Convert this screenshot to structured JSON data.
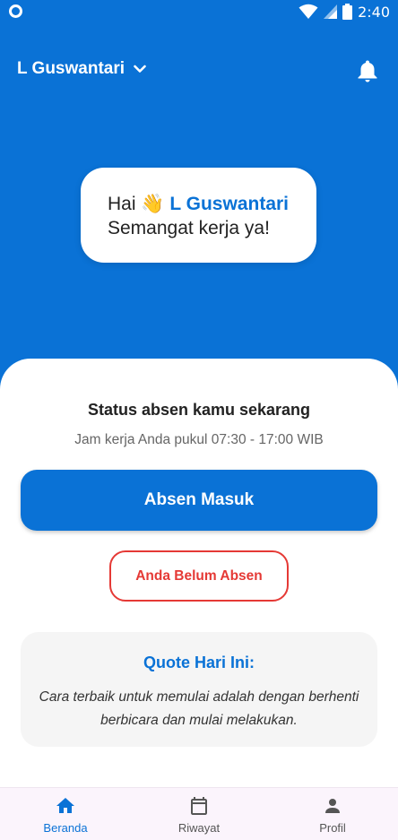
{
  "status_bar": {
    "time": "2:40",
    "icons": [
      "app-notification-icon",
      "wifi-icon",
      "signal-icon",
      "battery-icon"
    ]
  },
  "header": {
    "user_name": "L Guswantari",
    "dropdown_icon": "chevron-down-icon",
    "notification_icon": "bell-icon"
  },
  "greeting": {
    "prefix": "Hai",
    "emoji": "👋",
    "name": "L Guswantari",
    "message": "Semangat kerja ya!"
  },
  "attendance": {
    "title": "Status absen kamu sekarang",
    "work_hours": "Jam kerja Anda pukul 07:30 - 17:00 WIB",
    "checkin_button": "Absen Masuk",
    "status_badge": "Anda Belum Absen"
  },
  "quote": {
    "title": "Quote Hari Ini:",
    "text": "Cara terbaik untuk memulai adalah dengan berhenti berbicara dan mulai melakukan."
  },
  "bottom_nav": {
    "items": [
      {
        "label": "Beranda",
        "icon": "home-icon",
        "active": true
      },
      {
        "label": "Riwayat",
        "icon": "calendar-icon",
        "active": false
      },
      {
        "label": "Profil",
        "icon": "person-icon",
        "active": false
      }
    ]
  },
  "colors": {
    "primary": "#0a72d6",
    "danger": "#e53935",
    "nav_background": "#fbf4fc"
  }
}
